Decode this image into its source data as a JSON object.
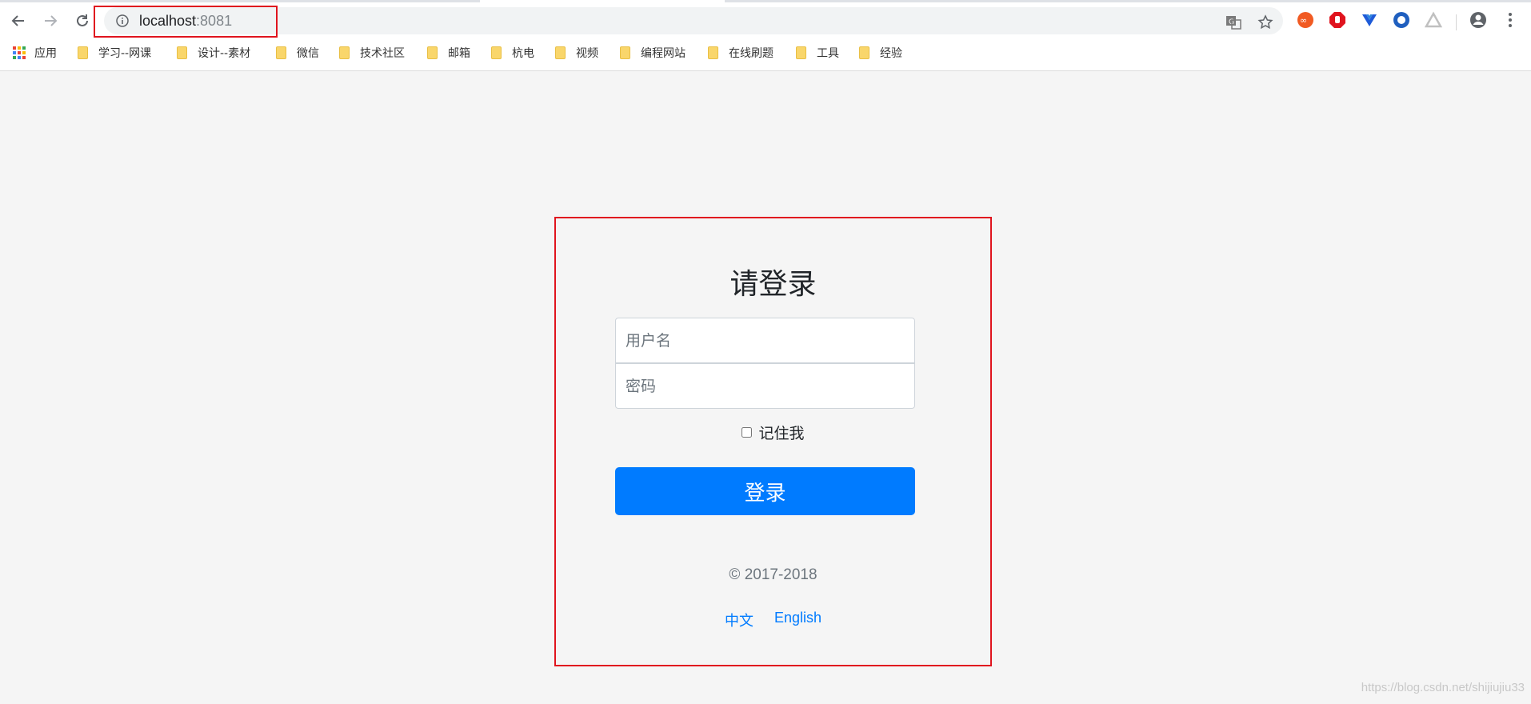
{
  "browser": {
    "url_host": "localhost",
    "url_port": ":8081",
    "bookmarks": [
      {
        "label": "应用",
        "icon": "apps-grid-icon"
      },
      {
        "label": "学习--网课",
        "icon": "folder-icon"
      },
      {
        "label": "设计--素材",
        "icon": "folder-icon"
      },
      {
        "label": "微信",
        "icon": "folder-icon"
      },
      {
        "label": "技术社区",
        "icon": "folder-icon"
      },
      {
        "label": "邮箱",
        "icon": "folder-icon"
      },
      {
        "label": "杭电",
        "icon": "folder-icon"
      },
      {
        "label": "视频",
        "icon": "folder-icon"
      },
      {
        "label": "编程网站",
        "icon": "folder-icon"
      },
      {
        "label": "在线刷题",
        "icon": "folder-icon"
      },
      {
        "label": "工具",
        "icon": "folder-icon"
      },
      {
        "label": "经验",
        "icon": "folder-icon"
      }
    ],
    "colors": {
      "accent_highlight": "#e0141e",
      "folder": "#f9d66b"
    }
  },
  "login": {
    "title": "请登录",
    "username_placeholder": "用户名",
    "password_placeholder": "密码",
    "remember_label": "记住我",
    "submit_label": "登录",
    "copyright": "© 2017-2018",
    "lang_zh": "中文",
    "lang_en": "English",
    "colors": {
      "primary": "#007bff",
      "background": "#f5f5f5",
      "highlight_box": "#e0141e"
    }
  },
  "watermark": "https://blog.csdn.net/shijiujiu33"
}
